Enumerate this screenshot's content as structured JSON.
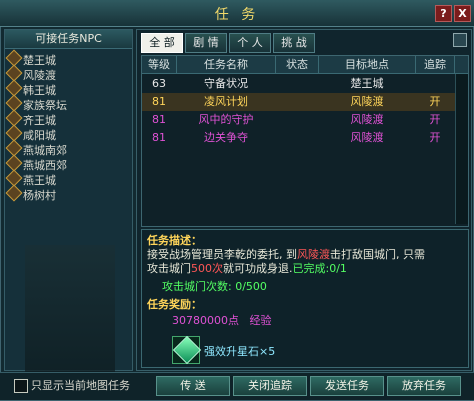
{
  "window": {
    "title": "任 务",
    "help_label": "?",
    "close_label": "X"
  },
  "left_panel": {
    "header": "可接任务NPC",
    "items": [
      "楚王城",
      "风陵渡",
      "韩王城",
      "家族祭坛",
      "齐王城",
      "咸阳城",
      "燕城南郊",
      "燕城西郊",
      "燕王城",
      "杨树村"
    ]
  },
  "tabs": [
    {
      "label": "全 部",
      "active": true
    },
    {
      "label": "剧 情",
      "active": false
    },
    {
      "label": "个 人",
      "active": false
    },
    {
      "label": "挑 战",
      "active": false
    }
  ],
  "table": {
    "columns": [
      "等级",
      "任务名称",
      "状态",
      "目标地点",
      "追踪"
    ],
    "rows": [
      {
        "level": "63",
        "name": "守备状况",
        "status": "",
        "target": "楚王城",
        "track": ""
      },
      {
        "level": "81",
        "name": "凌风计划",
        "status": "",
        "target": "风陵渡",
        "track": "开"
      },
      {
        "level": "81",
        "name": "风中的守护",
        "status": "",
        "target": "风陵渡",
        "track": "开"
      },
      {
        "level": "81",
        "name": "边关争夺",
        "status": "",
        "target": "风陵渡",
        "track": "开"
      }
    ]
  },
  "details": {
    "desc_title": "任务描述：",
    "desc_line1_a": "接受战场管理员李乾的委托, 到",
    "desc_line1_place": "风陵渡",
    "desc_line1_b": "击打敌国城门, 只需",
    "desc_line2_a": "攻击城门",
    "desc_line2_count": "500次",
    "desc_line2_b": "就可功成身退.",
    "desc_line2_done": "已完成:0/1",
    "progress_text": "攻击城门次数: 0/500",
    "reward_title": "任务奖励：",
    "reward_exp_value": "30780000点",
    "reward_exp_label": "经验",
    "reward_item": "强效升星石×5"
  },
  "bottom": {
    "checkbox_label": "只显示当前地图任务",
    "buttons": [
      "传 送",
      "关闭追踪",
      "发送任务",
      "放弃任务"
    ]
  },
  "colors": {
    "gold": "#ffd55a",
    "green": "#53ff63",
    "red": "#ff5757",
    "purple": "#e052d5"
  },
  "icons": {
    "npc": "npc-diamond-icon",
    "reward": "gem-icon",
    "close": "close-icon",
    "help": "help-icon"
  }
}
